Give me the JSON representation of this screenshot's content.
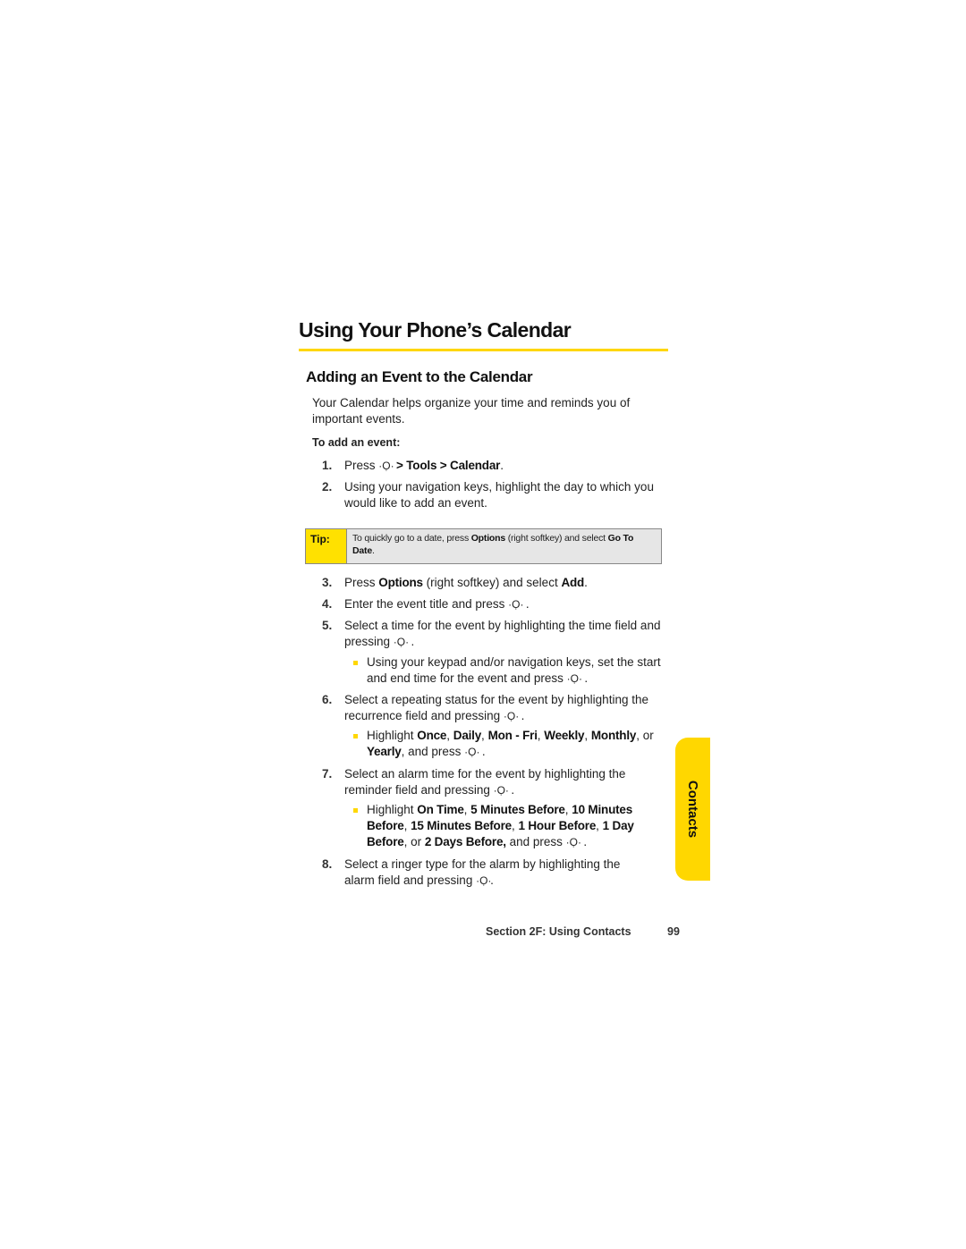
{
  "page": {
    "title": "Using Your Phone’s Calendar",
    "section_heading": "Adding an Event to the Calendar",
    "intro": "Your Calendar helps organize your time and reminds you of important events.",
    "procedure_label": "To add an event:",
    "key_icon": "menu-ok-key-icon",
    "key_glyph": "·Ọ·"
  },
  "steps": [
    {
      "num": "1.",
      "parts": [
        "Press ",
        "[key]",
        " ",
        "**> Tools > Calendar**",
        "."
      ]
    },
    {
      "num": "2.",
      "text": "Using your navigation keys, highlight the day to which you would like to add an event."
    },
    {
      "num": "3.",
      "parts": [
        "Press ",
        "**Options**",
        " (right softkey) and select ",
        "**Add**",
        "."
      ]
    },
    {
      "num": "4.",
      "parts": [
        "Enter the event title and press ",
        "[key]",
        " ."
      ]
    },
    {
      "num": "5.",
      "parts": [
        "Select a time for the event by highlighting the time field and pressing ",
        "[key]",
        " ."
      ]
    },
    {
      "num": "6.",
      "parts": [
        "Select a repeating status for the event by highlighting the recurrence field and pressing ",
        "[key]",
        " ."
      ]
    },
    {
      "num": "7.",
      "parts": [
        "Select an alarm time for the event by highlighting the reminder field and pressing ",
        "[key]",
        " ."
      ]
    },
    {
      "num": "8.",
      "parts": [
        "Select a ringer type for the alarm by highlighting the alarm field and pressing ",
        "[key]",
        "."
      ]
    }
  ],
  "substeps": [
    {
      "parts": [
        "Using your keypad and/or navigation keys, set the start and end time for the event and press ",
        "[key]",
        " ."
      ]
    },
    {
      "parts": [
        "Highlight ",
        "**Once**",
        ", ",
        "**Daily**",
        ", ",
        "**Mon - Fri**",
        ", ",
        "**Weekly**",
        ", ",
        "**Monthly**",
        ", or ",
        "**Yearly**",
        ", and press ",
        "[key]",
        " ."
      ]
    },
    {
      "parts": [
        "Highlight ",
        "**On Time**",
        ", ",
        "**5 Minutes Before**",
        ", ",
        "**10 Minutes Before**",
        ", ",
        "**15 Minutes Before**",
        ", ",
        "**1 Hour Before**",
        ", ",
        "**1 Day Before**",
        ", or ",
        "**2 Days Before,**",
        " and press ",
        "[key]",
        " ."
      ]
    }
  ],
  "tip": {
    "label": "Tip:",
    "parts": [
      "To quickly go to a date, press ",
      "**Options**",
      " (right softkey) and select ",
      "**Go To Date**",
      "."
    ]
  },
  "side_tab": {
    "label": "Contacts",
    "color": "#ffd700"
  },
  "footer": {
    "section": "Section 2F: Using Contacts",
    "page_number": "99"
  },
  "colors": {
    "accent": "#ffd700",
    "tip_label_bg": "#ffe100",
    "tip_body_bg": "#e6e6e6"
  }
}
